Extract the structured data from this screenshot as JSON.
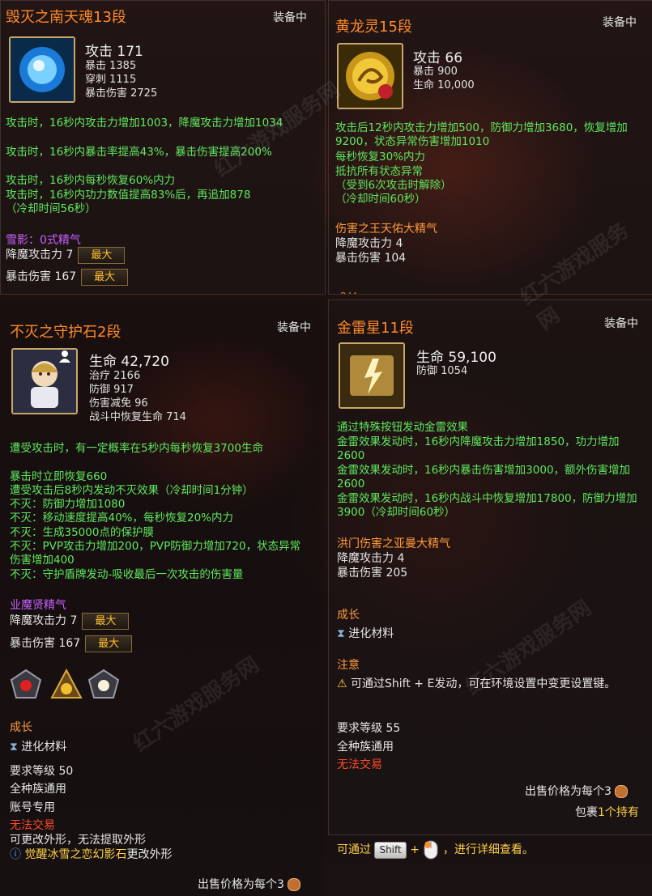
{
  "equip_label": "装备中",
  "max_label": "最大",
  "panel1": {
    "title": "毁灭之南天魂13段",
    "main_stat": "攻击 171",
    "stats": [
      "暴击 1385",
      "穿刺 1115",
      "暴击伤害 2725"
    ],
    "effects": [
      "攻击时，16秒内攻击力增加1003，降魔攻击力增加1034",
      "攻击时，16秒内暴击率提高43%，暴击伤害提高200%",
      "攻击时，16秒内每秒恢复60%内力",
      "攻击时，16秒内功力数值提高83%后，再追加878",
      "（冷却时间56秒）"
    ],
    "essence_title": "雪影：0式精气",
    "essence_stats": [
      "降魔攻击力 7",
      "暴击伤害 167"
    ]
  },
  "panel2": {
    "title": "黄龙灵15段",
    "main_stat": "攻击 66",
    "stats": [
      "暴击 900",
      "生命 10,000"
    ],
    "effects": [
      "攻击后12秒内攻击力增加500，防御力增加3680，恢复增加9200，状态异常伤害增加1010",
      "每秒恢复30%内力",
      "抵抗所有状态异常",
      "（受到6次攻击时解除）",
      "（冷却时间60秒）"
    ],
    "essence_title": "伤害之王天佑大精气",
    "essence_stats": [
      "降魔攻击力 4",
      "暴击伤害 104"
    ],
    "growth_label": "成长"
  },
  "panel3": {
    "title": "不灭之守护石2段",
    "main_stat": "生命 42,720",
    "stats": [
      "治疗 2166",
      "防御 917",
      "伤害减免 96",
      "战斗中恢复生命 714"
    ],
    "effects": [
      "遭受攻击时，有一定概率在5秒内每秒恢复3700生命",
      "暴击时立即恢复660",
      "遭受攻击后8秒内发动不灭效果（冷却时间1分钟）",
      "不灭：防御力增加1080",
      "不灭：移动速度提高40%，每秒恢复20%内力",
      "不灭：生成35000点的保护膜",
      "不灭：PVP攻击力增加200，PVP防御力增加720，状态异常伤害增加400",
      "不灭：守护盾牌发动-吸收最后一次攻击的伤害量"
    ],
    "essence_title": "业魔贤精气",
    "essence_stats": [
      "降魔攻击力 7",
      "暴击伤害 167"
    ],
    "growth_label": "成长",
    "growth_item": "进化材料",
    "info": [
      "要求等级 50",
      "全种族通用",
      "账号专用"
    ],
    "untradeable": "无法交易",
    "appearance_note": "可更改外形，无法提取外形",
    "appearance_stone": "觉醒冰雪之恋幻影石",
    "appearance_suffix": "更改外形",
    "sell_price": "出售价格为每个3"
  },
  "panel4": {
    "title": "金雷星11段",
    "main_stat": "生命 59,100",
    "stats": [
      "防御 1054"
    ],
    "effects": [
      "通过特殊按钮发动金雷效果",
      "金雷效果发动时，16秒内降魔攻击力增加1850，功力增加2600",
      "金雷效果发动时，16秒内暴击伤害增加3000，额外伤害增加2600",
      "金雷效果发动时，16秒内战斗中恢复增加17800，防御力增加3900（冷却时间60秒）"
    ],
    "essence_title": "洪门伤害之亚曼大精气",
    "essence_stats": [
      "降魔攻击力 4",
      "暴击伤害 205"
    ],
    "growth_label": "成长",
    "growth_item": "进化材料",
    "note_title": "注意",
    "note_text": "可通过Shift + E发动，可在环境设置中变更设置键。",
    "info": [
      "要求等级 55",
      "全种族通用"
    ],
    "untradeable": "无法交易",
    "sell_price": "出售价格为每个3",
    "bag_prefix": "包裹",
    "bag_count": "1个持有",
    "hint_prefix": "可通过",
    "hint_key": "Shift",
    "hint_plus": "+",
    "hint_suffix": "，进行详细查看。"
  },
  "watermark": "红六游戏服务网"
}
